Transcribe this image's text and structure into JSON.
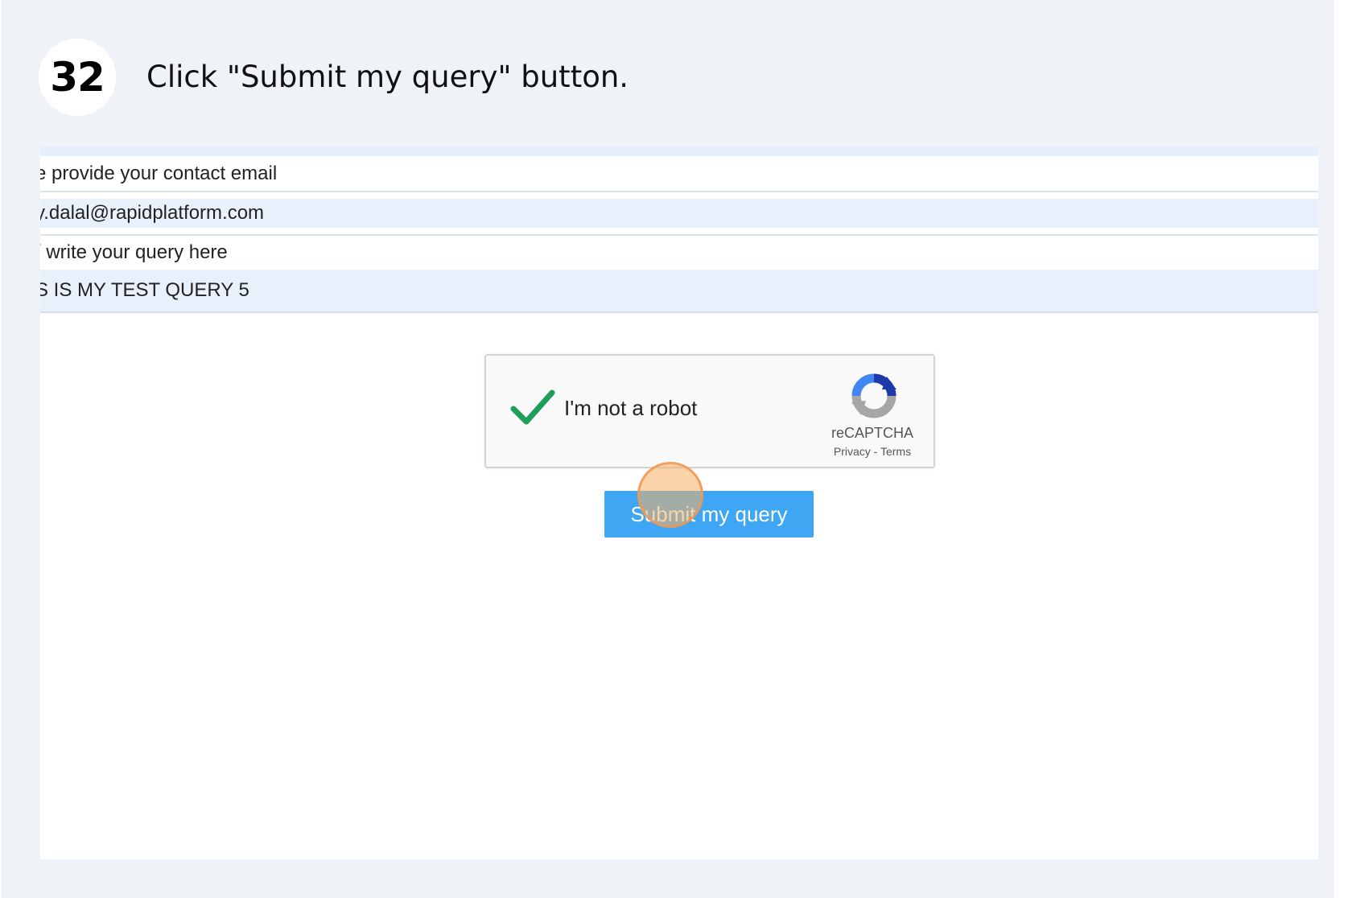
{
  "tutorial": {
    "step_number": "32",
    "instruction": "Click \"Submit my query\" button."
  },
  "form": {
    "email_label": "e provide your contact email",
    "email_value": "y.dalal@rapidplatform.com",
    "query_label": "/ write your query here",
    "query_value": "S IS MY TEST QUERY 5"
  },
  "captcha": {
    "label": "I'm not a robot",
    "brand": "reCAPTCHA",
    "links": "Privacy - Terms",
    "checked": true,
    "check_color": "#1e9e5a"
  },
  "submit": {
    "label": "Submit my query",
    "color": "#3ea6f2"
  },
  "highlight_color": "#f8b068"
}
